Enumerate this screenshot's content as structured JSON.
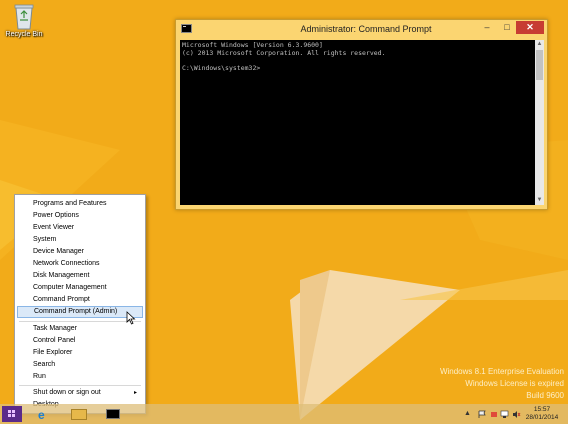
{
  "desktop": {
    "recycle_bin_label": "Recycle Bin"
  },
  "cmd_window": {
    "title": "Administrator: Command Prompt",
    "minimize_glyph": "–",
    "maximize_glyph": "□",
    "close_glyph": "✕",
    "console_lines": [
      "Microsoft Windows [Version 6.3.9600]",
      "(c) 2013 Microsoft Corporation. All rights reserved.",
      "C:\\Windows\\system32>"
    ]
  },
  "winx_menu": {
    "items": [
      {
        "label": "Programs and Features"
      },
      {
        "label": "Power Options"
      },
      {
        "label": "Event Viewer"
      },
      {
        "label": "System"
      },
      {
        "label": "Device Manager"
      },
      {
        "label": "Network Connections"
      },
      {
        "label": "Disk Management"
      },
      {
        "label": "Computer Management"
      },
      {
        "label": "Command Prompt"
      },
      {
        "label": "Command Prompt (Admin)"
      },
      {
        "label": "Task Manager"
      },
      {
        "label": "Control Panel"
      },
      {
        "label": "File Explorer"
      },
      {
        "label": "Search"
      },
      {
        "label": "Run"
      },
      {
        "label": "Shut down or sign out"
      },
      {
        "label": "Desktop"
      }
    ],
    "highlighted_item": "Command Prompt (Admin)",
    "submenu_arrow": "▸"
  },
  "watermark": {
    "line1": "Windows 8.1 Enterprise Evaluation",
    "line2": "Windows License is expired",
    "line3": "Build 9600"
  },
  "taskbar": {
    "ie_glyph": "e",
    "clock_time": "15:57",
    "clock_date": "28/01/2014",
    "tray_up_glyph": "▲"
  },
  "colors": {
    "desktop_bg": "#f2ab19",
    "menu_highlight": "#dbe9f8",
    "close_button": "#c73c32",
    "start_button": "#5a2a8a"
  }
}
